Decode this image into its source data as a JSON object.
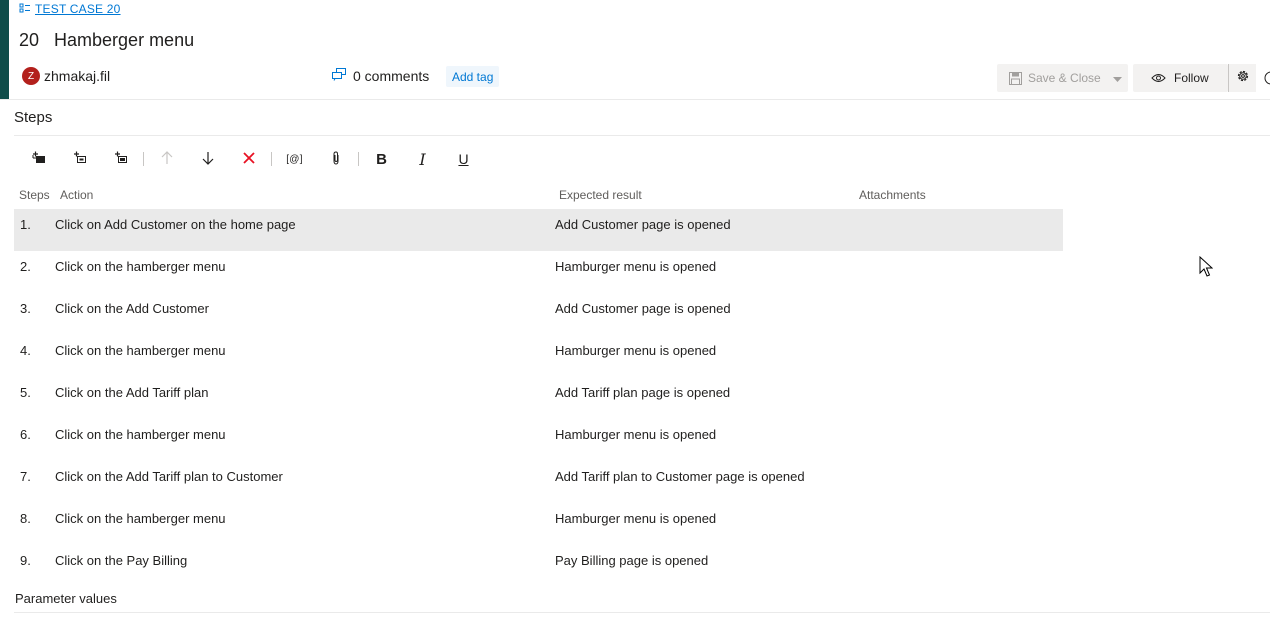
{
  "work_item": {
    "type_label": "TEST CASE 20",
    "id": "20",
    "title": "Hamberger menu",
    "author_initial": "Z",
    "author_name": "zhmakaj.fil",
    "comments_label": "0 comments",
    "add_tag_label": "Add tag"
  },
  "header_actions": {
    "save_label": "Save & Close",
    "follow_label": "Follow"
  },
  "colors": {
    "accent": "#0f4d4a",
    "link": "#0078d4",
    "avatar": "#b3201c",
    "delete": "#e81123"
  },
  "steps_section": {
    "title": "Steps",
    "columns": {
      "steps": "Steps",
      "action": "Action",
      "expected": "Expected result",
      "attachments": "Attachments"
    },
    "toolbar": {
      "insert_param_label": "[@]",
      "bold_label": "B",
      "italic_label": "I",
      "underline_label": "U"
    },
    "rows": [
      {
        "num": "1.",
        "action": "Click on Add Customer on the home page",
        "expected": "Add Customer page is opened"
      },
      {
        "num": "2.",
        "action": "Click on the hamberger menu",
        "expected": "Hamburger menu is opened"
      },
      {
        "num": "3.",
        "action": "Click on the Add Customer",
        "expected": "Add Customer page is opened"
      },
      {
        "num": "4.",
        "action": "Click on the hamberger menu",
        "expected": "Hamburger menu is opened"
      },
      {
        "num": "5.",
        "action": "Click on the Add Tariff plan",
        "expected": "Add Tariff plan page is opened"
      },
      {
        "num": "6.",
        "action": "Click on the hamberger menu",
        "expected": "Hamburger menu is opened"
      },
      {
        "num": "7.",
        "action": "Click on the Add Tariff plan to Customer",
        "expected": "Add Tariff plan to Customer page is opened"
      },
      {
        "num": "8.",
        "action": "Click on the hamberger menu",
        "expected": "Hamburger menu is opened"
      },
      {
        "num": "9.",
        "action": "Click on the Pay Billing",
        "expected": "Pay Billing page is opened"
      }
    ]
  },
  "parameters_section": {
    "title": "Parameter values"
  }
}
